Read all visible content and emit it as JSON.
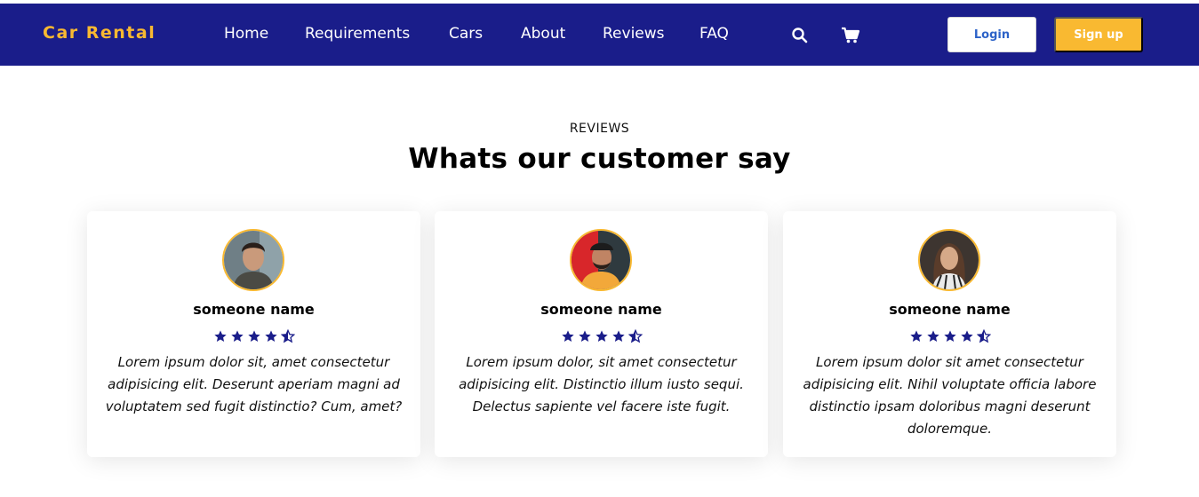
{
  "brand": {
    "name": "Car Rental"
  },
  "nav": {
    "links": [
      "Home",
      "Requirements",
      "Cars",
      "About",
      "Reviews",
      "FAQ"
    ],
    "search_icon": "search-icon",
    "cart_icon": "cart-icon",
    "login_label": "Login",
    "signup_label": "Sign up"
  },
  "reviews_section": {
    "label": "REVIEWS",
    "title": "Whats our customer say",
    "cards": [
      {
        "name": "someone name",
        "rating": 4.5,
        "text": "Lorem ipsum dolor sit, amet consectetur adipisicing elit. Deserunt aperiam magni ad voluptatem sed fugit distinctio? Cum, amet?"
      },
      {
        "name": "someone name",
        "rating": 4.5,
        "text": "Lorem ipsum dolor, sit amet consectetur adipisicing elit. Distinctio illum iusto sequi. Delectus sapiente vel facere iste fugit."
      },
      {
        "name": "someone name",
        "rating": 4.5,
        "text": "Lorem ipsum dolor sit amet consectetur adipisicing elit. Nihil voluptate officia labore distinctio ipsam doloribus magni deserunt doloremque."
      }
    ]
  },
  "colors": {
    "navbar_bg": "#1a1d8a",
    "accent": "#f9b931",
    "star": "#1a1d8a",
    "login_text": "#2d63c8"
  }
}
